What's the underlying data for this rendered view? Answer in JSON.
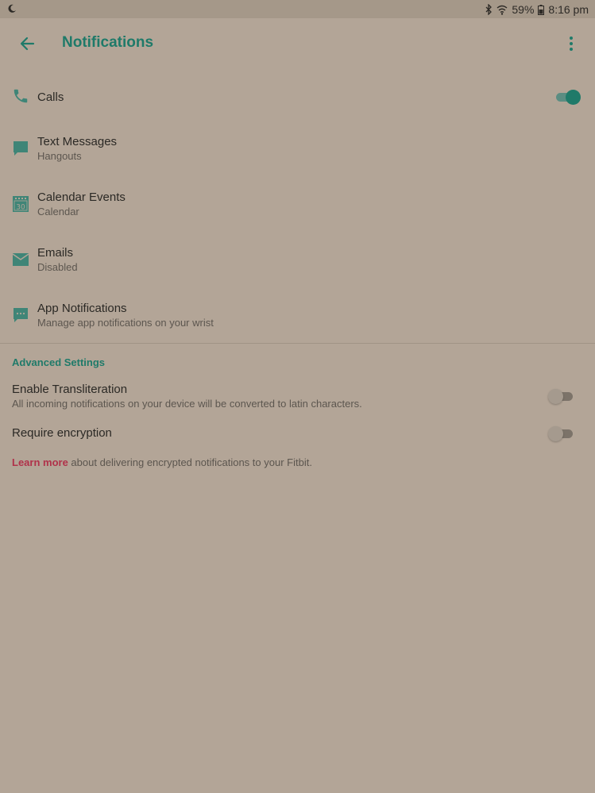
{
  "status_bar": {
    "battery": "59%",
    "time": "8:16 pm"
  },
  "header": {
    "title": "Notifications"
  },
  "notification_items": [
    {
      "title": "Calls",
      "subtitle": "",
      "toggle_on": true
    },
    {
      "title": "Text Messages",
      "subtitle": "Hangouts"
    },
    {
      "title": "Calendar Events",
      "subtitle": "Calendar",
      "icon_text": "30"
    },
    {
      "title": "Emails",
      "subtitle": "Disabled"
    },
    {
      "title": "App Notifications",
      "subtitle": "Manage app notifications on your wrist"
    }
  ],
  "advanced": {
    "heading": "Advanced Settings",
    "transliteration": {
      "title": "Enable Transliteration",
      "subtitle": "All incoming notifications on your device will be converted to latin characters.",
      "toggle_on": false
    },
    "encryption": {
      "title": "Require encryption",
      "toggle_on": false
    },
    "learn_more_link": "Learn more",
    "learn_more_text": " about delivering encrypted notifications to your Fitbit."
  },
  "colors": {
    "accent": "#1f7a69",
    "link": "#b0324a",
    "background": "#b3a597"
  }
}
